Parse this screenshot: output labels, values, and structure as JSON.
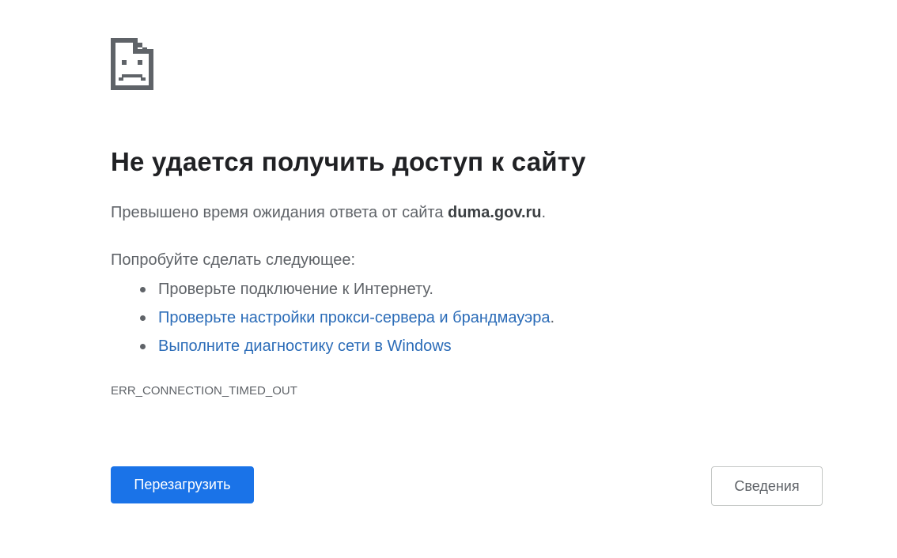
{
  "error_page": {
    "icon": "sad-document-icon",
    "title": "Не удается получить доступ к сайту",
    "description_prefix": "Превышено время ожидания ответа от сайта ",
    "host": "duma.gov.ru",
    "description_suffix": ".",
    "suggestions_heading": "Попробуйте сделать следующее:",
    "suggestions": [
      {
        "text": "Проверьте подключение к Интернету.",
        "link": false
      },
      {
        "text": "Проверьте настройки прокси-сервера и брандмауэра",
        "link": true,
        "suffix": "."
      },
      {
        "text": "Выполните диагностику сети в Windows",
        "link": true,
        "suffix": ""
      }
    ],
    "error_code": "ERR_CONNECTION_TIMED_OUT",
    "reload_button": "Перезагрузить",
    "details_button": "Сведения"
  },
  "colors": {
    "title": "#202124",
    "text": "#5f6368",
    "link": "#2b6cb8",
    "primary_button": "#1a73e8",
    "primary_button_text": "#ffffff",
    "secondary_button_border": "#c4c7c5"
  }
}
